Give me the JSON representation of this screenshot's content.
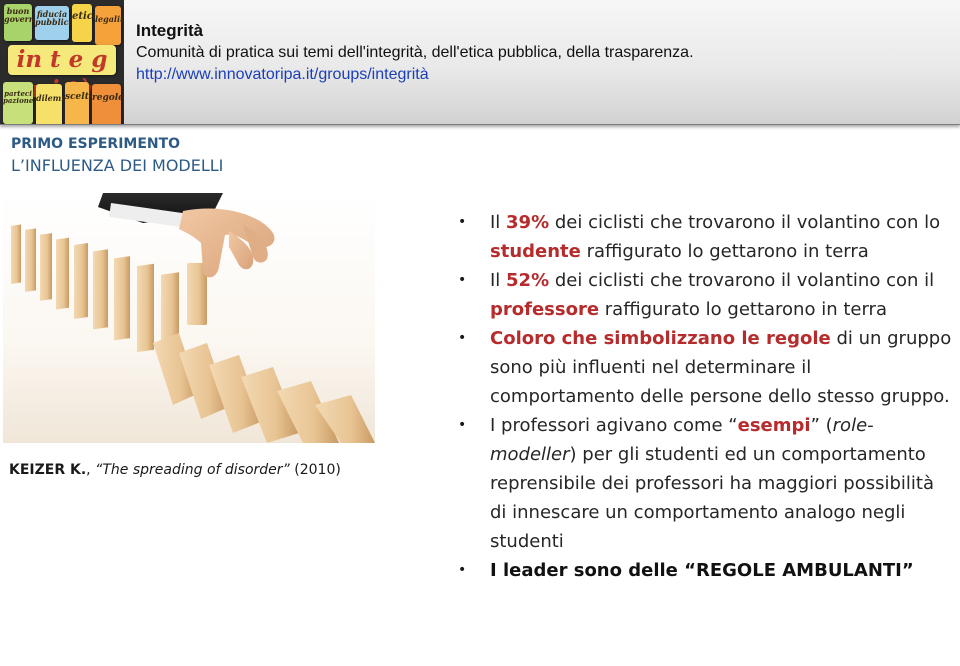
{
  "header": {
    "title": "Integrità",
    "subtitle": "Comunità di pratica sui temi dell'integrità, dell'etica pubblica, della trasparenza.",
    "url": "http://www.innovatoripa.it/groups/integrità",
    "logo_words": [
      "buongoverno",
      "fiducia",
      "pubblica",
      "etica",
      "legalità",
      "integrità",
      "partecipazione",
      "dilemma",
      "scelta",
      "regole"
    ]
  },
  "section": {
    "kicker": "PRIMO ESPERIMENTO",
    "title": "L’INFLUENZA DEI MODELLI"
  },
  "credit": {
    "author": "KEIZER K.",
    "sep": ",",
    "work": "The spreading of disorder",
    "year": "(2010)"
  },
  "bullets": {
    "b1": {
      "pre": "Il ",
      "pct": "39%",
      "mid": " dei ciclisti che trovarono il volantino con lo ",
      "who": "studente",
      "post": " raffigurato lo gettarono in terra"
    },
    "b2": {
      "pre": "Il ",
      "pct": "52%",
      "mid": " dei ciclisti che trovarono il volantino con il ",
      "who": "professore",
      "post": " raffigurato lo gettarono in terra"
    },
    "b3": {
      "hl": "Coloro che simbolizzano le regole",
      "post": " di un gruppo sono più influenti nel determinare il comportamento delle persone dello stesso gruppo."
    },
    "b4": {
      "pre": "I professori agivano come “",
      "bold": "esempi",
      "mid": "” (",
      "italic": "role-modeller",
      "post": ") per gli studenti ed un comportamento reprensibile dei professori ha maggiori possibilità di innescare un comportamento analogo negli studenti"
    },
    "b5": {
      "text": "I leader sono delle “REGOLE AMBULANTI”"
    }
  },
  "colors": {
    "accent_red": "#b62b2b",
    "heading_blue": "#2d5b86",
    "link_blue": "#1a3eb8"
  }
}
